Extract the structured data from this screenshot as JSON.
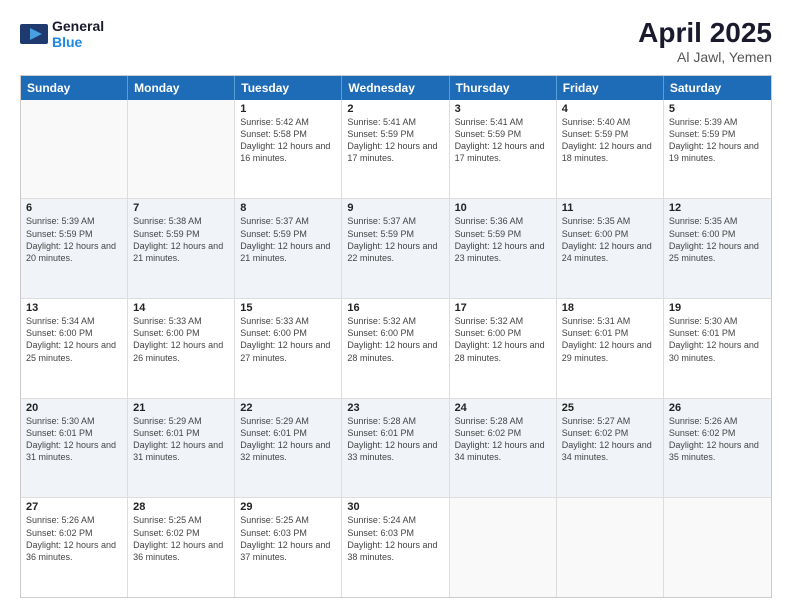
{
  "header": {
    "logo_line1": "General",
    "logo_line2": "Blue",
    "month_title": "April 2025",
    "location": "Al Jawl, Yemen"
  },
  "days_of_week": [
    "Sunday",
    "Monday",
    "Tuesday",
    "Wednesday",
    "Thursday",
    "Friday",
    "Saturday"
  ],
  "weeks": [
    [
      {
        "day": "",
        "empty": true
      },
      {
        "day": "",
        "empty": true
      },
      {
        "day": "1",
        "sunrise": "5:42 AM",
        "sunset": "5:58 PM",
        "daylight": "12 hours and 16 minutes."
      },
      {
        "day": "2",
        "sunrise": "5:41 AM",
        "sunset": "5:59 PM",
        "daylight": "12 hours and 17 minutes."
      },
      {
        "day": "3",
        "sunrise": "5:41 AM",
        "sunset": "5:59 PM",
        "daylight": "12 hours and 17 minutes."
      },
      {
        "day": "4",
        "sunrise": "5:40 AM",
        "sunset": "5:59 PM",
        "daylight": "12 hours and 18 minutes."
      },
      {
        "day": "5",
        "sunrise": "5:39 AM",
        "sunset": "5:59 PM",
        "daylight": "12 hours and 19 minutes."
      }
    ],
    [
      {
        "day": "6",
        "sunrise": "5:39 AM",
        "sunset": "5:59 PM",
        "daylight": "12 hours and 20 minutes."
      },
      {
        "day": "7",
        "sunrise": "5:38 AM",
        "sunset": "5:59 PM",
        "daylight": "12 hours and 21 minutes."
      },
      {
        "day": "8",
        "sunrise": "5:37 AM",
        "sunset": "5:59 PM",
        "daylight": "12 hours and 21 minutes."
      },
      {
        "day": "9",
        "sunrise": "5:37 AM",
        "sunset": "5:59 PM",
        "daylight": "12 hours and 22 minutes."
      },
      {
        "day": "10",
        "sunrise": "5:36 AM",
        "sunset": "5:59 PM",
        "daylight": "12 hours and 23 minutes."
      },
      {
        "day": "11",
        "sunrise": "5:35 AM",
        "sunset": "6:00 PM",
        "daylight": "12 hours and 24 minutes."
      },
      {
        "day": "12",
        "sunrise": "5:35 AM",
        "sunset": "6:00 PM",
        "daylight": "12 hours and 25 minutes."
      }
    ],
    [
      {
        "day": "13",
        "sunrise": "5:34 AM",
        "sunset": "6:00 PM",
        "daylight": "12 hours and 25 minutes."
      },
      {
        "day": "14",
        "sunrise": "5:33 AM",
        "sunset": "6:00 PM",
        "daylight": "12 hours and 26 minutes."
      },
      {
        "day": "15",
        "sunrise": "5:33 AM",
        "sunset": "6:00 PM",
        "daylight": "12 hours and 27 minutes."
      },
      {
        "day": "16",
        "sunrise": "5:32 AM",
        "sunset": "6:00 PM",
        "daylight": "12 hours and 28 minutes."
      },
      {
        "day": "17",
        "sunrise": "5:32 AM",
        "sunset": "6:00 PM",
        "daylight": "12 hours and 28 minutes."
      },
      {
        "day": "18",
        "sunrise": "5:31 AM",
        "sunset": "6:01 PM",
        "daylight": "12 hours and 29 minutes."
      },
      {
        "day": "19",
        "sunrise": "5:30 AM",
        "sunset": "6:01 PM",
        "daylight": "12 hours and 30 minutes."
      }
    ],
    [
      {
        "day": "20",
        "sunrise": "5:30 AM",
        "sunset": "6:01 PM",
        "daylight": "12 hours and 31 minutes."
      },
      {
        "day": "21",
        "sunrise": "5:29 AM",
        "sunset": "6:01 PM",
        "daylight": "12 hours and 31 minutes."
      },
      {
        "day": "22",
        "sunrise": "5:29 AM",
        "sunset": "6:01 PM",
        "daylight": "12 hours and 32 minutes."
      },
      {
        "day": "23",
        "sunrise": "5:28 AM",
        "sunset": "6:01 PM",
        "daylight": "12 hours and 33 minutes."
      },
      {
        "day": "24",
        "sunrise": "5:28 AM",
        "sunset": "6:02 PM",
        "daylight": "12 hours and 34 minutes."
      },
      {
        "day": "25",
        "sunrise": "5:27 AM",
        "sunset": "6:02 PM",
        "daylight": "12 hours and 34 minutes."
      },
      {
        "day": "26",
        "sunrise": "5:26 AM",
        "sunset": "6:02 PM",
        "daylight": "12 hours and 35 minutes."
      }
    ],
    [
      {
        "day": "27",
        "sunrise": "5:26 AM",
        "sunset": "6:02 PM",
        "daylight": "12 hours and 36 minutes."
      },
      {
        "day": "28",
        "sunrise": "5:25 AM",
        "sunset": "6:02 PM",
        "daylight": "12 hours and 36 minutes."
      },
      {
        "day": "29",
        "sunrise": "5:25 AM",
        "sunset": "6:03 PM",
        "daylight": "12 hours and 37 minutes."
      },
      {
        "day": "30",
        "sunrise": "5:24 AM",
        "sunset": "6:03 PM",
        "daylight": "12 hours and 38 minutes."
      },
      {
        "day": "",
        "empty": true
      },
      {
        "day": "",
        "empty": true
      },
      {
        "day": "",
        "empty": true
      }
    ]
  ]
}
